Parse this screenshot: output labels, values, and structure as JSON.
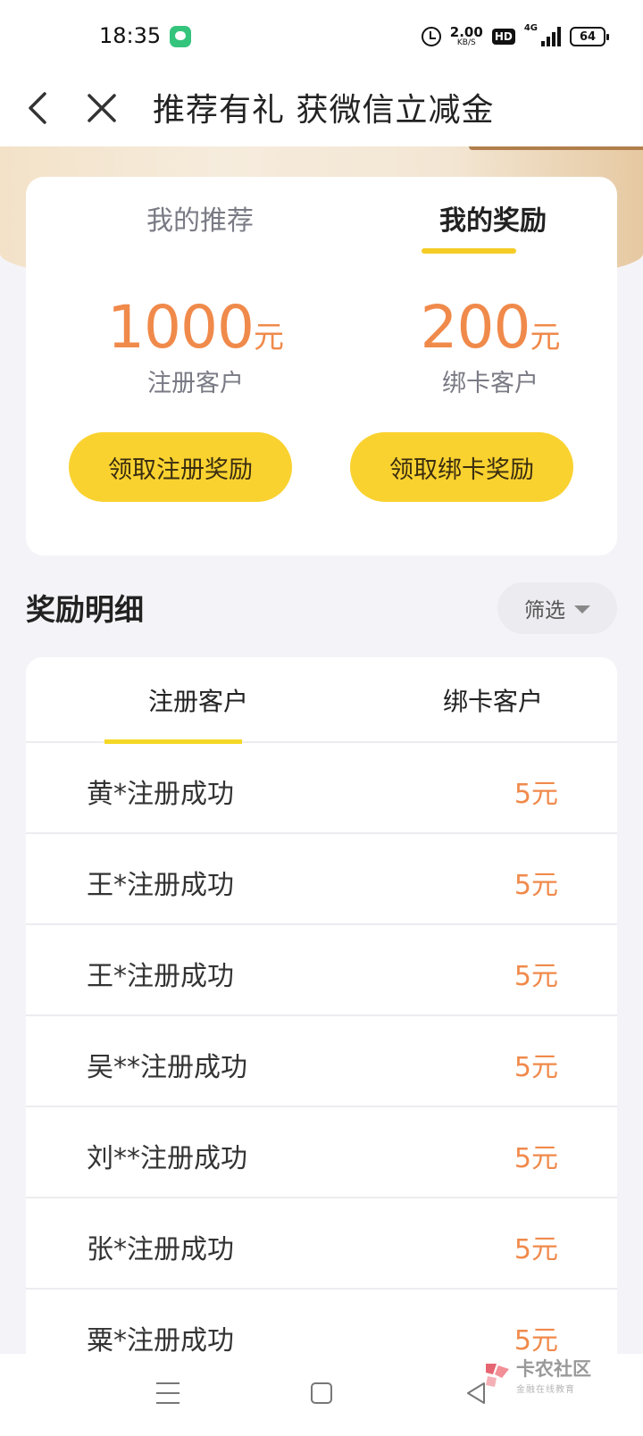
{
  "status_bar": {
    "time": "18:35",
    "net_speed": "2.00",
    "net_unit": "KB/S",
    "hd": "HD",
    "network": "4G",
    "battery": "64"
  },
  "nav": {
    "title": "推荐有礼 获微信立减金"
  },
  "card": {
    "tabs": [
      "我的推荐",
      "我的奖励"
    ],
    "active_tab": "我的奖励",
    "stats": [
      {
        "value": "1000",
        "unit": "元",
        "label": "注册客户",
        "button": "领取注册奖励"
      },
      {
        "value": "200",
        "unit": "元",
        "label": "绑卡客户",
        "button": "领取绑卡奖励"
      }
    ]
  },
  "details": {
    "title": "奖励明细",
    "filter": "筛选",
    "tabs": [
      "注册客户",
      "绑卡客户"
    ],
    "active_tab": "注册客户",
    "rows": [
      {
        "name": "黄*注册成功",
        "amount": "5元"
      },
      {
        "name": "王*注册成功",
        "amount": "5元"
      },
      {
        "name": "王*注册成功",
        "amount": "5元"
      },
      {
        "name": "吴**注册成功",
        "amount": "5元"
      },
      {
        "name": "刘**注册成功",
        "amount": "5元"
      },
      {
        "name": "张*注册成功",
        "amount": "5元"
      },
      {
        "name": "粟*注册成功",
        "amount": "5元"
      }
    ]
  },
  "watermark": {
    "main": "卡农社区",
    "sub": "金融在线教育"
  },
  "colors": {
    "accent_yellow": "#fad230",
    "amount_orange": "#f08a4b"
  }
}
